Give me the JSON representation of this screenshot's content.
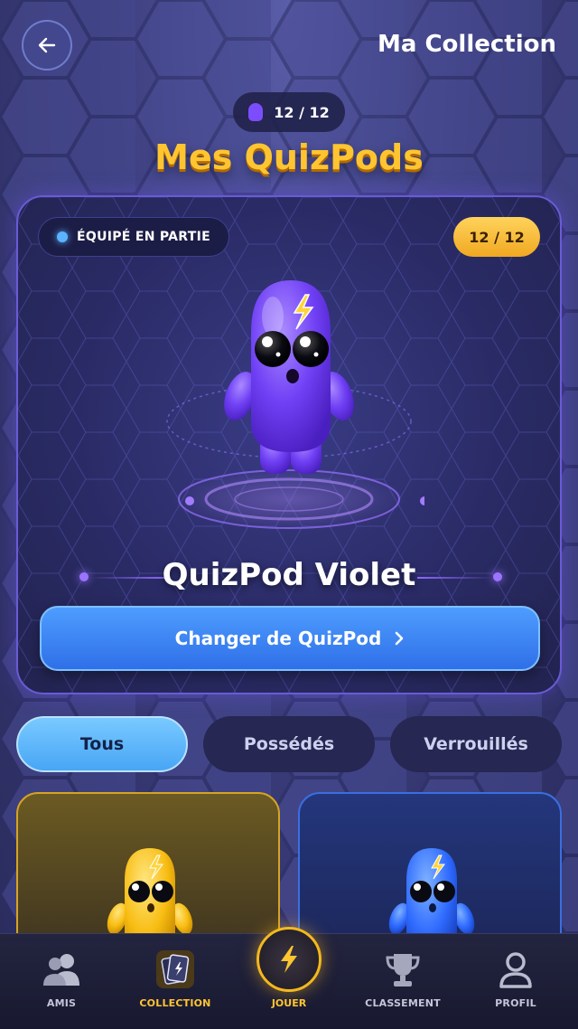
{
  "header": {
    "title": "Ma Collection",
    "back_icon": "arrow-left-icon",
    "counter": "12 / 12"
  },
  "page_title": "Mes QuizPods",
  "hero": {
    "status_label": "ÉQUIPÉ EN PARTIE",
    "count_label": "12 / 12",
    "pod_name": "QuizPod Violet",
    "pod_color": "#7a4dff",
    "change_button_label": "Changer de QuizPod",
    "change_button_icon": "chevron-right-icon"
  },
  "filters": {
    "tabs": [
      {
        "label": "Tous",
        "active": true
      },
      {
        "label": "Possédés",
        "active": false
      },
      {
        "label": "Verrouillés",
        "active": false
      }
    ]
  },
  "grid": {
    "cards": [
      {
        "color": "#ffc21a",
        "frame": "#d5a424"
      },
      {
        "color": "#2f6bff",
        "frame": "#3a6fe0"
      }
    ]
  },
  "nav": {
    "items": [
      {
        "label": "AMIS",
        "icon": "friends-icon",
        "active": false
      },
      {
        "label": "COLLECTION",
        "icon": "cards-icon",
        "active": true
      },
      {
        "label": "JOUER",
        "icon": "lightning-icon",
        "active": false
      },
      {
        "label": "CLASSEMENT",
        "icon": "trophy-icon",
        "active": false
      },
      {
        "label": "PROFIL",
        "icon": "profile-icon",
        "active": false
      }
    ]
  },
  "colors": {
    "accent_gold": "#ffc531",
    "accent_blue": "#4e9dff",
    "background": "#3d3f7e"
  }
}
